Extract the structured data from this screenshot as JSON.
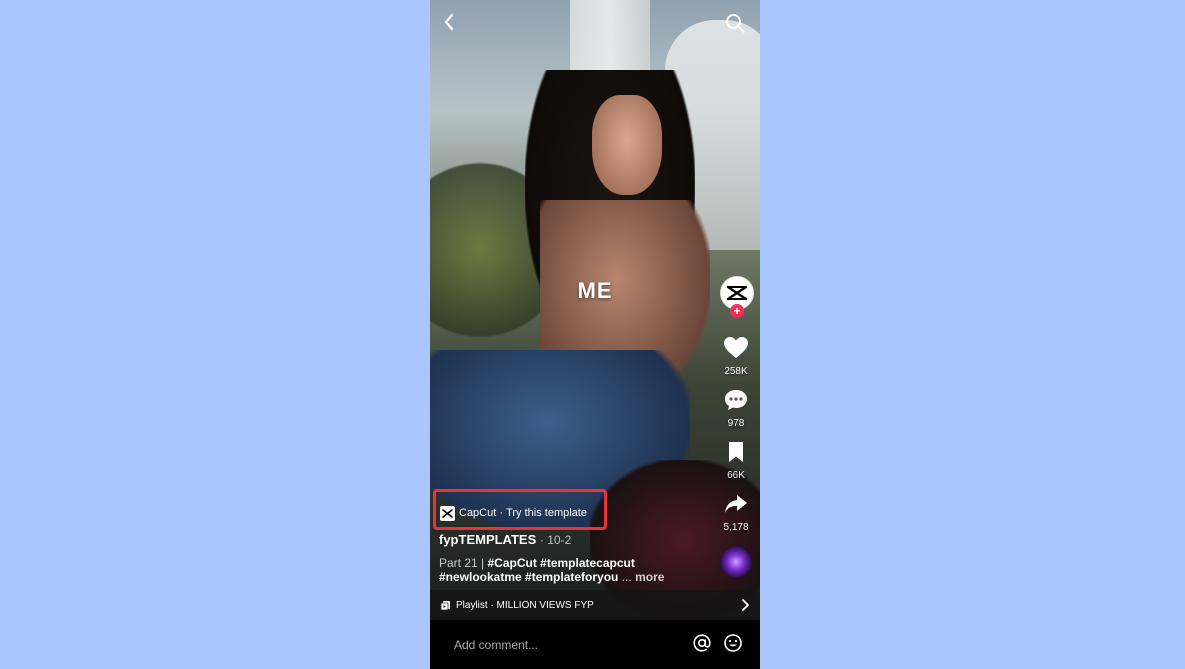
{
  "colors": {
    "page_background": "#abc6ff",
    "follow_badge": "#fe2c55",
    "highlight_border": "#e5343a",
    "comment_bar": "#000000"
  },
  "video": {
    "overlay_text": "ME"
  },
  "header": {
    "back_icon": "chevron-left-icon",
    "search_icon": "search-icon"
  },
  "rail": {
    "creator_avatar_icon": "capcut-logo-icon",
    "follow_icon": "plus-icon",
    "likes": "258K",
    "comments": "978",
    "saves": "66K",
    "shares": "5,178"
  },
  "template": {
    "brand": "CapCut",
    "separator": " · ",
    "cta": "Try this template"
  },
  "post": {
    "username": "fypTEMPLATES",
    "date": "· 10-2",
    "part": "Part 21 | ",
    "hashtags": "#CapCut #templatecapcut #newlookatme #templateforyou",
    "ellipsis": " ... ",
    "more": "more"
  },
  "playlist": {
    "label": "Playlist · MILLION VIEWS FYP"
  },
  "comment": {
    "placeholder": "Add comment..."
  }
}
